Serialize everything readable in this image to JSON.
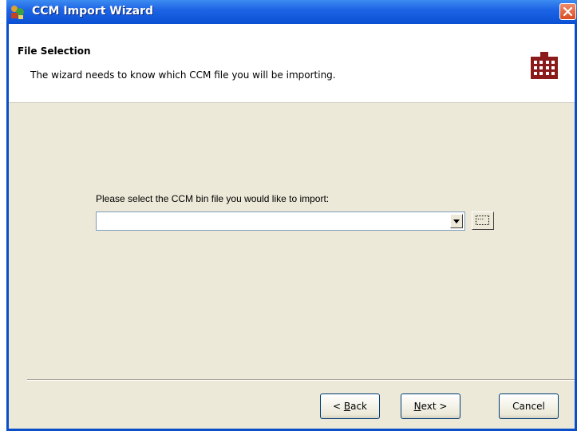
{
  "window": {
    "title": "CCM Import Wizard",
    "title_bar_color": "#0A50D4",
    "close_icon": "close-icon"
  },
  "header": {
    "title": "File Selection",
    "subtitle": "The wizard needs to know which CCM file you will be importing.",
    "logo_icon": "building-grid-icon",
    "logo_color": "#8B1A1A"
  },
  "form": {
    "prompt": "Please select the CCM bin file you would like to import:",
    "file_value": "",
    "browse_label": "..."
  },
  "buttons": {
    "back": {
      "prefix": "< ",
      "accel": "B",
      "rest": "ack"
    },
    "next": {
      "accel": "N",
      "rest": "ext >"
    },
    "cancel": "Cancel"
  },
  "colors": {
    "dialog_bg": "#ECE9D8",
    "header_bg": "#FFFFFF"
  }
}
